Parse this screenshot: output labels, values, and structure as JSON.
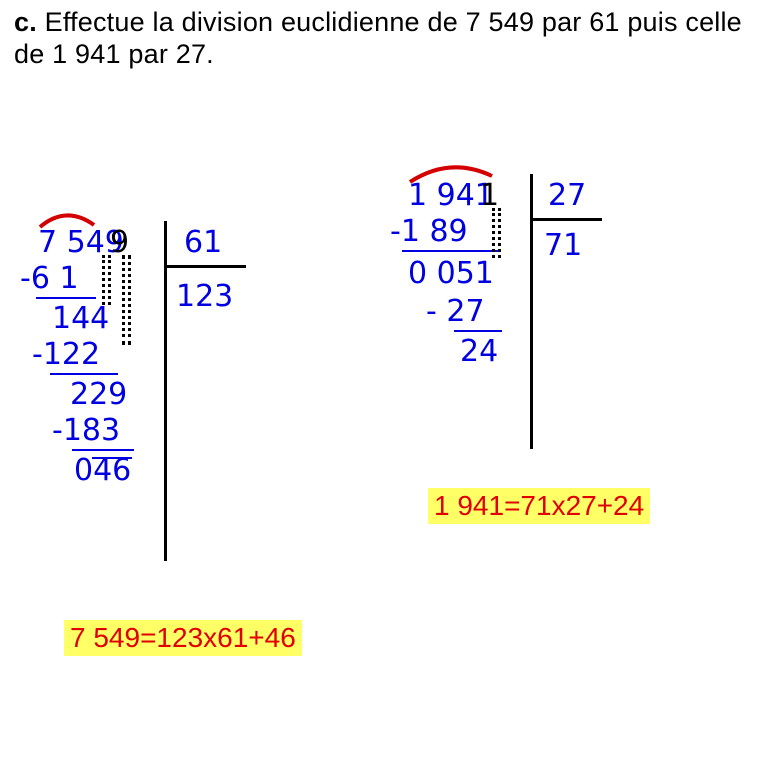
{
  "question": {
    "label": "c.",
    "text": "Effectue la division euclidienne de 7 549 par 61 puis celle de 1 941 par 27."
  },
  "div1": {
    "dividend": "7 549",
    "divisor": "61",
    "quotient": "123",
    "step1_sub": "-6 1",
    "step1_res": "144",
    "step2_sub": "-122",
    "step2_res": "229",
    "step3_sub": "-183",
    "remainder": "046",
    "equation": "7 549=123x61+46"
  },
  "div2": {
    "dividend": "1 941",
    "divisor": "27",
    "quotient": "71",
    "step1_sub": "-1 89",
    "step1_res": "0 051",
    "step2_sub": "- 27",
    "remainder": "24",
    "equation": "1 941=71x27+24"
  }
}
